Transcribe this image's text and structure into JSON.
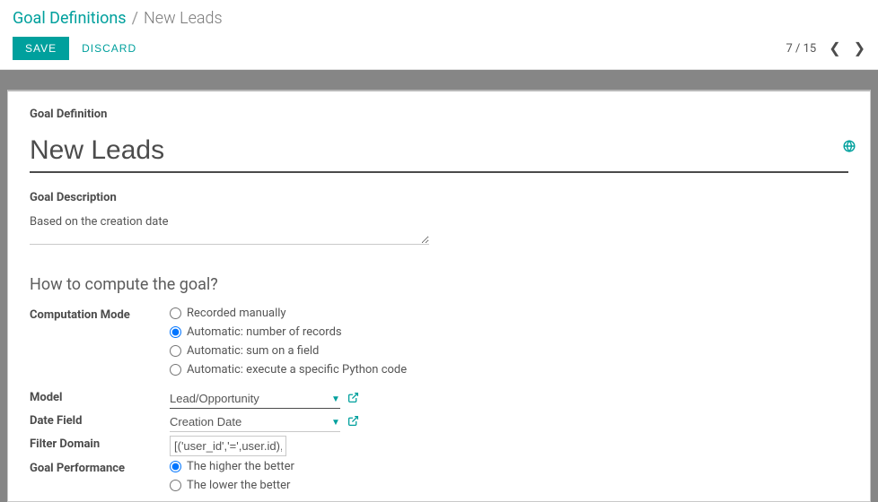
{
  "header": {
    "breadcrumb_root": "Goal Definitions",
    "breadcrumb_sep": "/",
    "breadcrumb_active": "New Leads",
    "save_label": "SAVE",
    "discard_label": "DISCARD",
    "pager_text": "7 / 15"
  },
  "form": {
    "definition_label": "Goal Definition",
    "title_value": "New Leads",
    "description_label": "Goal Description",
    "description_value": "Based on the creation date",
    "section_heading": "How to compute the goal?",
    "comp_mode_label": "Computation Mode",
    "comp_modes": {
      "manual": "Recorded manually",
      "count": "Automatic: number of records",
      "sum": "Automatic: sum on a field",
      "python": "Automatic: execute a specific Python code"
    },
    "model_label": "Model",
    "model_value": "Lead/Opportunity",
    "date_field_label": "Date Field",
    "date_field_value": "Creation Date",
    "filter_label": "Filter Domain",
    "filter_value": "[('user_id','=',user.id), '|', ('t",
    "perf_label": "Goal Performance",
    "perf_higher": "The higher the better",
    "perf_lower": "The lower the better"
  }
}
